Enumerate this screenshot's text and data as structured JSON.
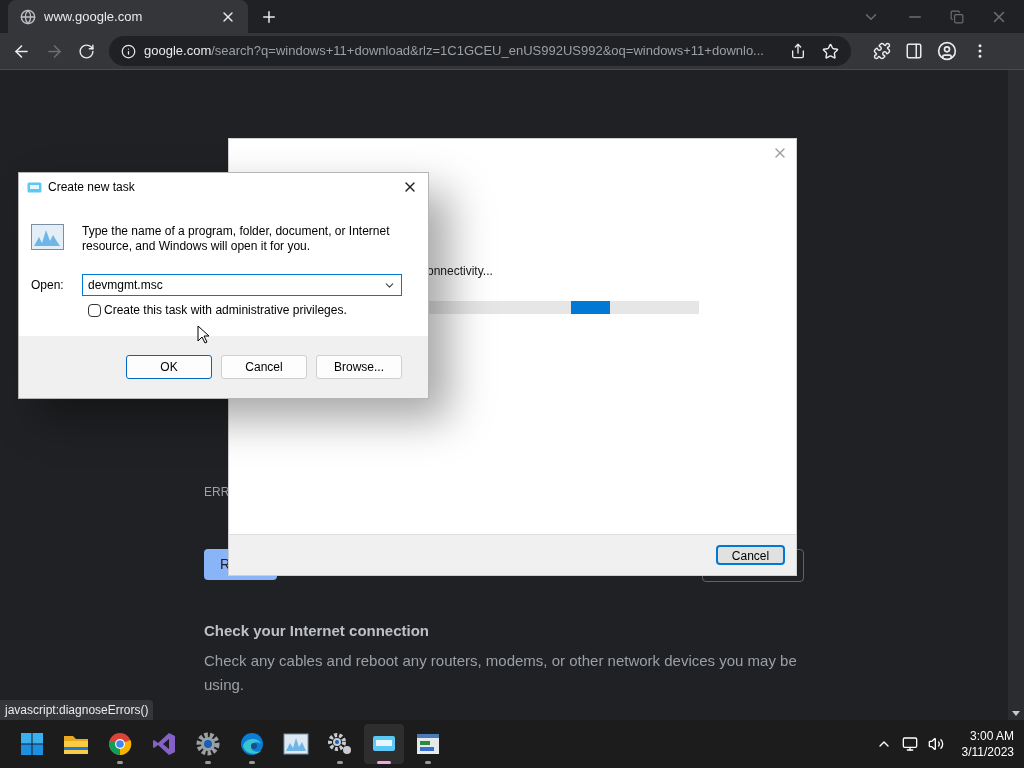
{
  "browser": {
    "tabs": [
      {
        "title": "www.google.com",
        "selected": true
      }
    ],
    "address": {
      "domain": "google.com",
      "path": "/search?q=windows+11+download&rlz=1C1GCEU_enUS992US992&oq=windows+11+downlo..."
    }
  },
  "error_page": {
    "code": "ERR",
    "reload_button": "R",
    "heading": "Check your Internet connection",
    "body": "Check any cables and reboot any routers, modems, or other network devices you may be using."
  },
  "progress_dialog": {
    "status": "onnectivity...",
    "cancel_button": "Cancel"
  },
  "run_dialog": {
    "title": "Create new task",
    "description": "Type the name of a program, folder, document, or Internet resource, and Windows will open it for you.",
    "open_label": "Open:",
    "value": "devmgmt.msc",
    "admin_checkbox": {
      "label": "Create this task with administrative privileges.",
      "checked": false
    },
    "buttons": [
      {
        "label": "OK",
        "default": true
      },
      {
        "label": "Cancel",
        "default": false
      },
      {
        "label": "Browse...",
        "default": false
      }
    ]
  },
  "status_link": "javascript:diagnoseErrors()",
  "taskbar": {
    "apps": [
      {
        "kind": "start",
        "running": false,
        "selected": false
      },
      {
        "kind": "folder",
        "running": false,
        "selected": false
      },
      {
        "kind": "browser",
        "running": true,
        "selected": false
      },
      {
        "kind": "ribbon",
        "running": false,
        "selected": false
      },
      {
        "kind": "settings",
        "running": true,
        "selected": false
      },
      {
        "kind": "wave",
        "running": true,
        "selected": false
      },
      {
        "kind": "monitor",
        "running": false,
        "selected": false
      },
      {
        "kind": "gears",
        "running": true,
        "selected": false
      },
      {
        "kind": "dialog",
        "running": true,
        "selected": true
      },
      {
        "kind": "panel",
        "running": true,
        "selected": false
      }
    ],
    "clock": {
      "time": "3:00 AM",
      "date": "3/11/2023"
    }
  }
}
